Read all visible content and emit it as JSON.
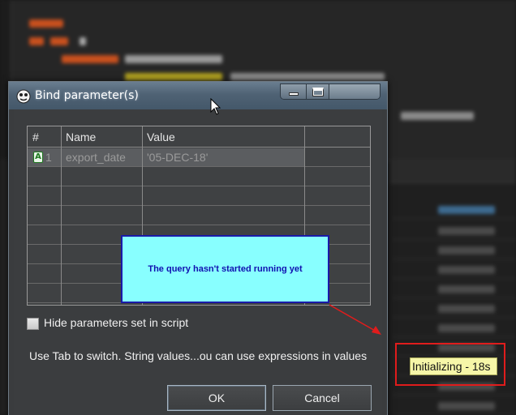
{
  "dialog": {
    "title": "Bind parameter(s)",
    "columns": [
      "#",
      "Name",
      "Value"
    ],
    "rows": [
      {
        "index": "1",
        "name": "export_date",
        "value": "'05-DEC-18'",
        "type_icon": "A"
      }
    ],
    "hide_params_label": "Hide parameters set in script",
    "hide_params_checked": false,
    "hint": "Use Tab to switch. String values...ou can use expressions in values",
    "ok_label": "OK",
    "cancel_label": "Cancel"
  },
  "annotation": {
    "message": "The query hasn't started running yet",
    "status": "Initializing - 18s"
  },
  "colors": {
    "annotation_fill": "#88ffff",
    "annotation_border": "#1a1aa8",
    "highlight_red": "#e01c1c",
    "status_badge": "#f6f6a8"
  }
}
